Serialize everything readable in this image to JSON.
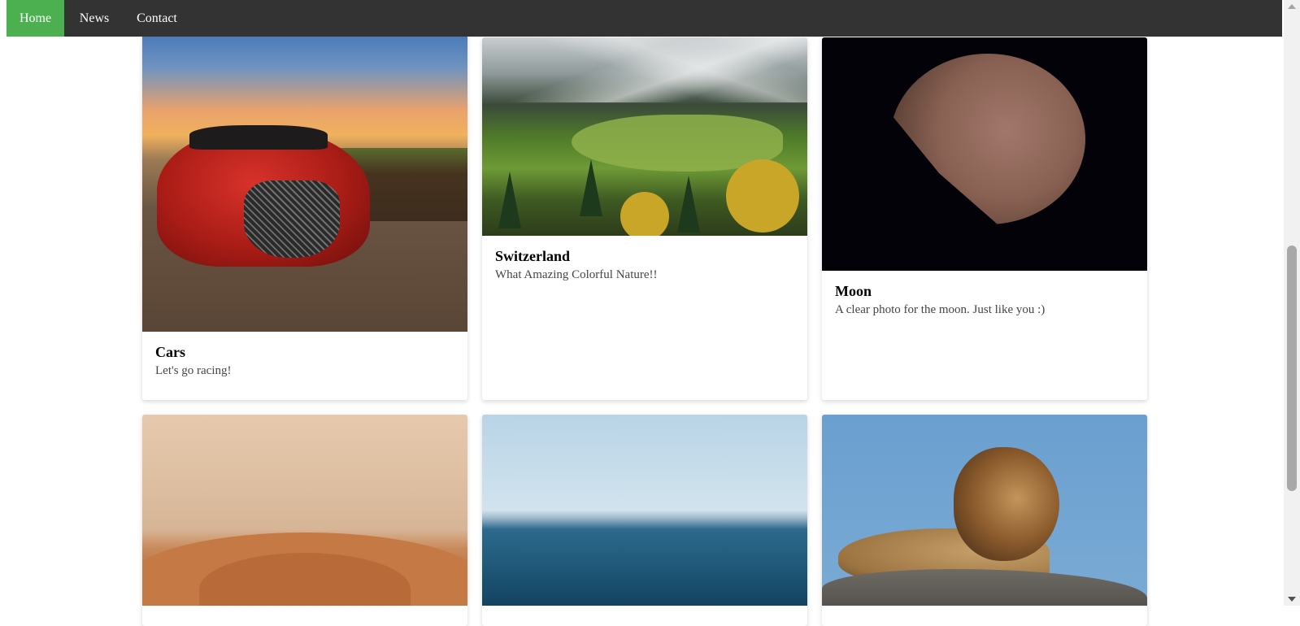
{
  "nav": {
    "items": [
      {
        "label": "Home",
        "active": true
      },
      {
        "label": "News",
        "active": false
      },
      {
        "label": "Contact",
        "active": false
      }
    ],
    "active_color": "#4caf50",
    "bar_color": "#333333"
  },
  "cards": [
    {
      "title": "Cars",
      "description": "Let's go racing!",
      "image": "red-sports-car-photo"
    },
    {
      "title": "Switzerland",
      "description": "What Amazing Colorful Nature!!",
      "image": "swiss-alpine-valley-photo"
    },
    {
      "title": "Moon",
      "description": "A clear photo for the moon. Just like you :)",
      "image": "moon-photo"
    },
    {
      "title": "",
      "description": "",
      "image": "desert-dunes-photo"
    },
    {
      "title": "",
      "description": "",
      "image": "ocean-horizon-photo"
    },
    {
      "title": "",
      "description": "",
      "image": "lion-on-rock-photo"
    }
  ]
}
